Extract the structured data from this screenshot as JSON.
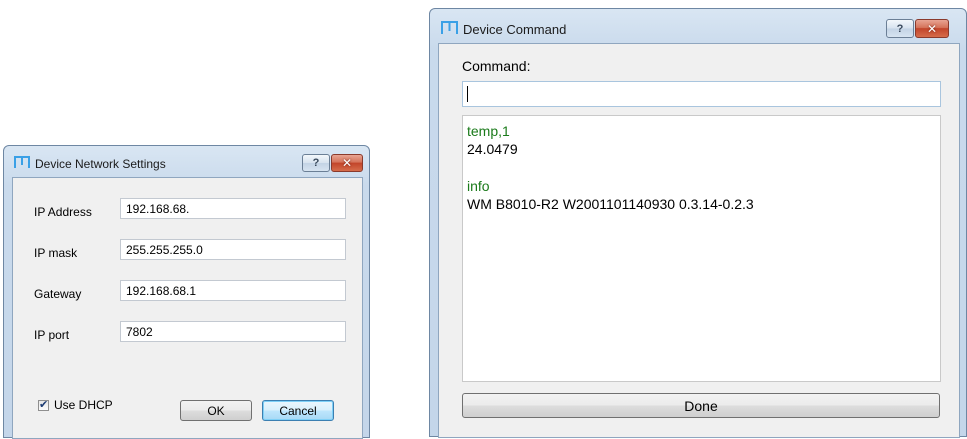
{
  "network_dialog": {
    "title": "Device Network Settings",
    "help_glyph": "?",
    "close_glyph": "✕",
    "fields": [
      {
        "label": "IP Address",
        "value": "192.168.68."
      },
      {
        "label": "IP mask",
        "value": "255.255.255.0"
      },
      {
        "label": "Gateway",
        "value": "192.168.68.1"
      },
      {
        "label": "IP port",
        "value": "7802"
      }
    ],
    "dhcp": {
      "label": "Use DHCP",
      "checked": true,
      "check_glyph": "✔"
    },
    "ok_label": "OK",
    "cancel_label": "Cancel"
  },
  "command_dialog": {
    "title": "Device Command",
    "help_glyph": "?",
    "close_glyph": "✕",
    "command_label": "Command:",
    "command_value": "",
    "output": [
      {
        "command": "temp,1",
        "response": "24.0479"
      },
      {
        "command": "info",
        "response": "WM B8010-R2 W2001101140930 0.3.14-0.2.3"
      }
    ],
    "done_label": "Done"
  },
  "colors": {
    "command_text": "#1a7a1a",
    "icon_blue": "#3aa0e6"
  },
  "icons": {
    "app": "m-logo-icon"
  }
}
